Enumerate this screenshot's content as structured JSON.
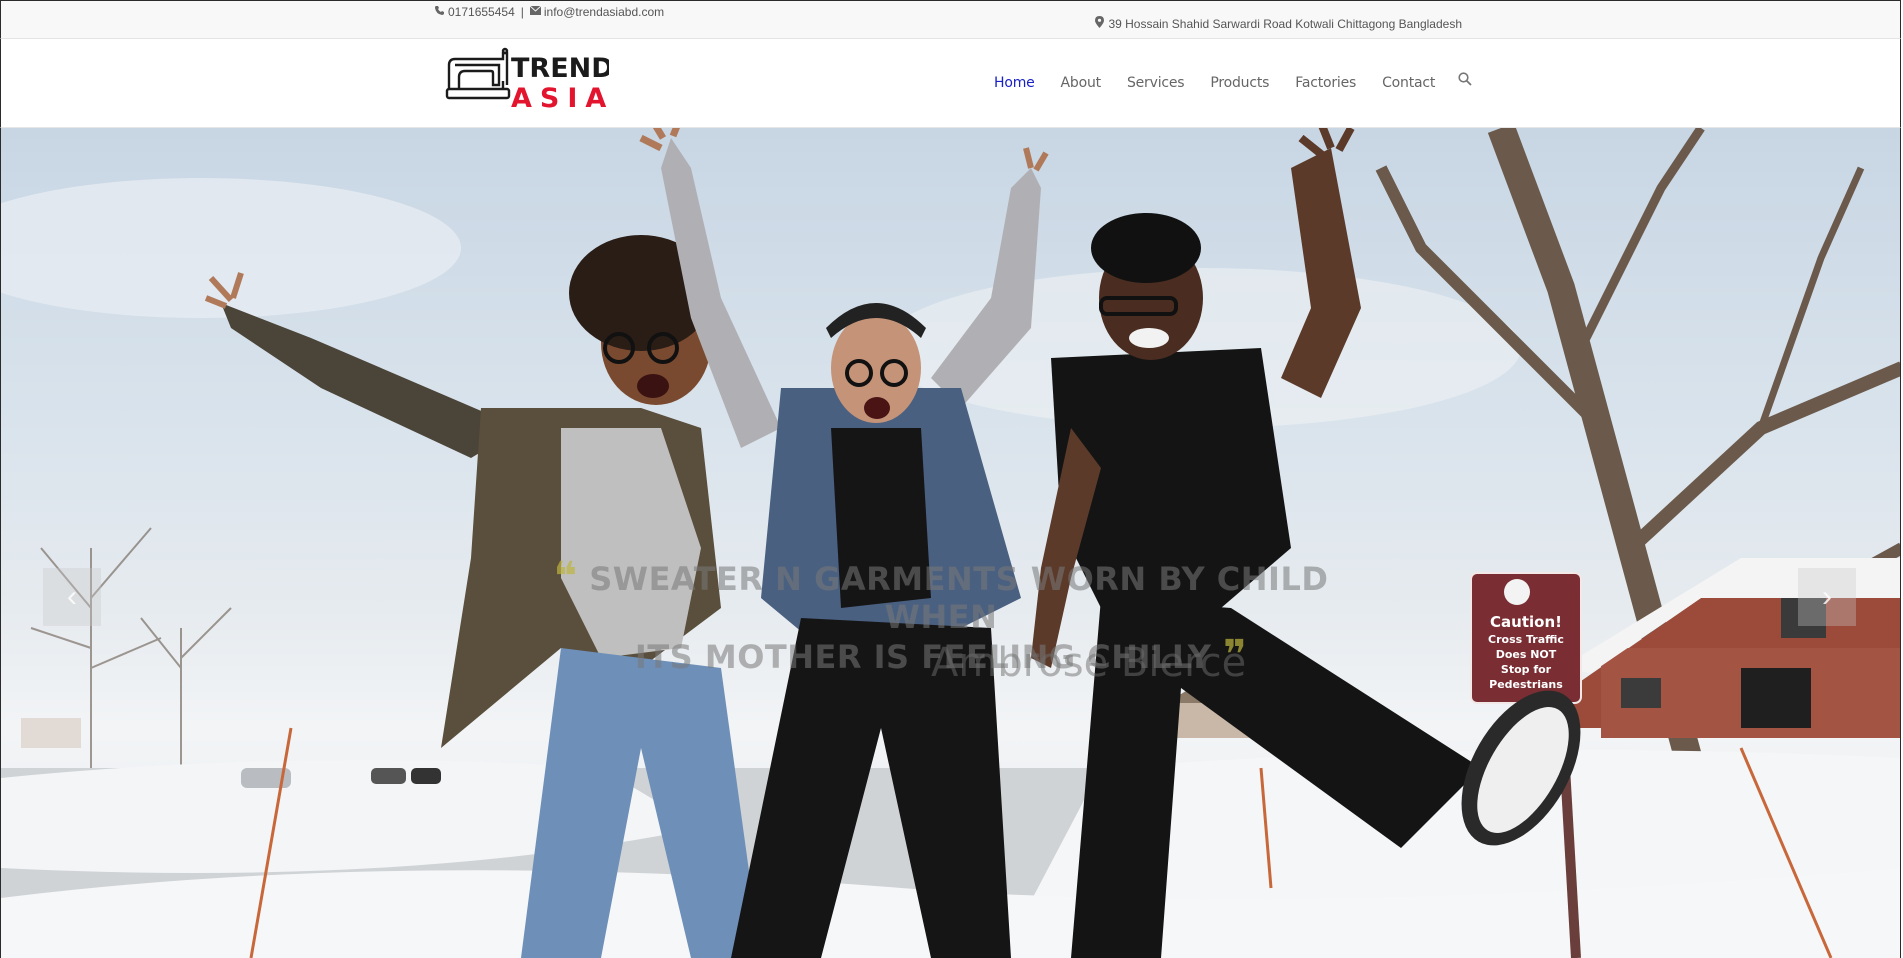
{
  "topbar": {
    "phone_icon": "phone-icon",
    "phone": "0171655454",
    "separator": "|",
    "email_icon": "envelope-icon",
    "email": "info@trendasiabd.com",
    "address_icon": "map-marker-icon",
    "address": "39 Hossain Shahid Sarwardi Road Kotwali Chittagong Bangladesh"
  },
  "logo": {
    "line1": "TREND",
    "line2": "ASIA",
    "brand_color": "#e3142d",
    "icon": "sewing-machine-icon"
  },
  "nav": {
    "items": [
      {
        "label": "Home",
        "active": true
      },
      {
        "label": "About"
      },
      {
        "label": "Services"
      },
      {
        "label": "Products"
      },
      {
        "label": "Factories"
      },
      {
        "label": "Contact"
      }
    ],
    "active_color": "#1a21c7",
    "search_icon": "search-icon"
  },
  "hero": {
    "quote_open": "❝",
    "quote_line1": "SWEATER N GARMENTS WORN BY CHILD WHEN",
    "quote_line2": "ITS MOTHER IS FEELING CHILLY",
    "quote_close": "❞",
    "author": "Ambrose Bierce",
    "sign_text": [
      "Caution!",
      "Cross Traffic",
      "Does NOT",
      "Stop for",
      "Pedestrians"
    ],
    "prev_icon": "chevron-left-icon",
    "next_icon": "chevron-right-icon"
  }
}
